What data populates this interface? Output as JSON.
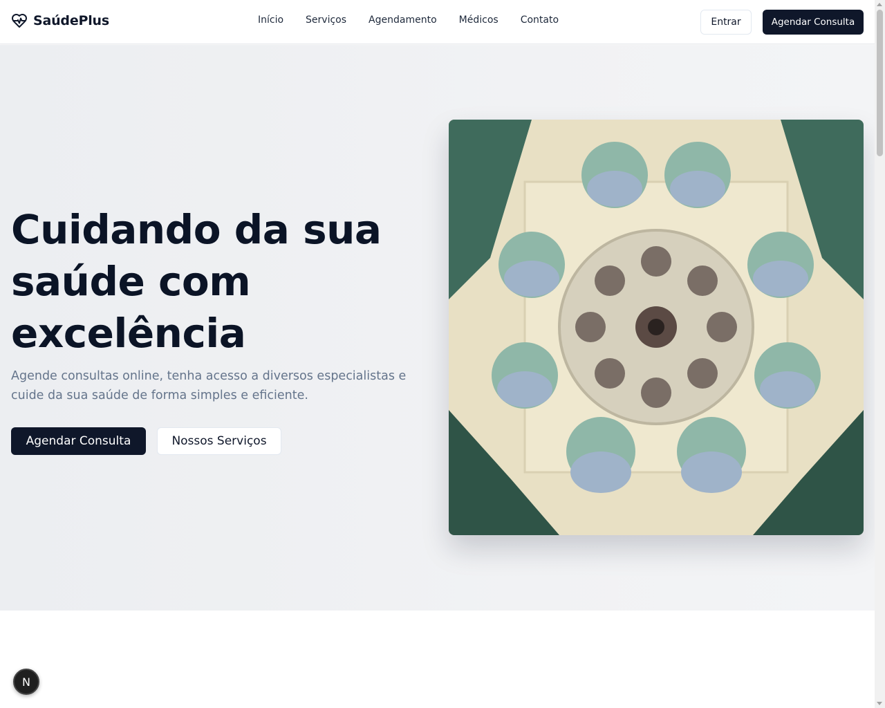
{
  "brand": {
    "name": "SaúdePlus"
  },
  "nav": {
    "items": [
      {
        "label": "Início"
      },
      {
        "label": "Serviços"
      },
      {
        "label": "Agendamento"
      },
      {
        "label": "Médicos"
      },
      {
        "label": "Contato"
      }
    ]
  },
  "header": {
    "login_label": "Entrar",
    "cta_label": "Agendar Consulta"
  },
  "hero": {
    "title": "Cuidando da sua saúde com excelência",
    "subtitle": "Agende consultas online, tenha acesso a diversos especialistas e cuide da sua saúde de forma simples e eficiente.",
    "primary_button": "Agendar Consulta",
    "secondary_button": "Nossos Serviços",
    "image_icon": "surgeons-photo"
  },
  "dev_badge": {
    "label": "N"
  },
  "colors": {
    "primary": "#0f172a",
    "muted_text": "#64748b",
    "hero_bg": "#eceef1"
  }
}
